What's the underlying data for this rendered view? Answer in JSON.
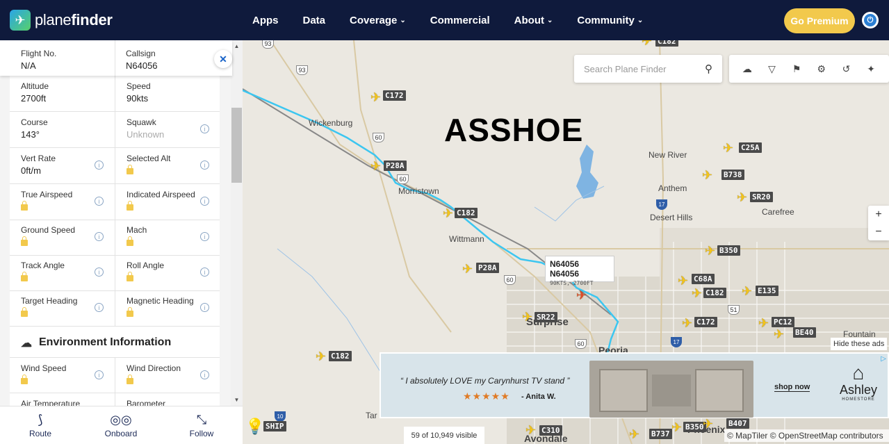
{
  "nav": {
    "brand_plain": "plane",
    "brand_bold": "finder",
    "links": [
      {
        "label": "Apps",
        "dropdown": false
      },
      {
        "label": "Data",
        "dropdown": false
      },
      {
        "label": "Coverage",
        "dropdown": true
      },
      {
        "label": "Commercial",
        "dropdown": false
      },
      {
        "label": "About",
        "dropdown": true
      },
      {
        "label": "Community",
        "dropdown": true
      }
    ],
    "premium_label": "Go Premium",
    "colors": {
      "bar": "#0f1a3c",
      "premium": "#f2c94c"
    }
  },
  "flight_panel": {
    "flight_no_label": "Flight No.",
    "flight_no_value": "N/A",
    "callsign_label": "Callsign",
    "callsign_value": "N64056",
    "close_icon": "close-icon",
    "rows": [
      {
        "left_label": "Altitude",
        "left_value": "2700ft",
        "right_label": "Speed",
        "right_value": "90kts"
      },
      {
        "left_label": "Course",
        "left_value": "143°",
        "right_label": "Squawk",
        "right_value": "Unknown"
      },
      {
        "left_label": "Vert Rate",
        "left_value": "0ft/m",
        "right_label": "Selected Alt",
        "right_value": ""
      },
      {
        "left_label": "True Airspeed",
        "left_value": "",
        "right_label": "Indicated Airspeed",
        "right_value": ""
      },
      {
        "left_label": "Ground Speed",
        "left_value": "",
        "right_label": "Mach",
        "right_value": ""
      },
      {
        "left_label": "Track Angle",
        "left_value": "",
        "right_label": "Roll Angle",
        "right_value": ""
      },
      {
        "left_label": "Target Heading",
        "left_value": "",
        "right_label": "Magnetic Heading",
        "right_value": ""
      }
    ],
    "environment_title": "Environment Information",
    "env_rows": [
      {
        "left_label": "Wind Speed",
        "right_label": "Wind Direction"
      },
      {
        "left_label": "Air Temperature",
        "right_label": "Barometer"
      }
    ]
  },
  "bottom_bar": {
    "items": [
      {
        "label": "Route",
        "icon": "route-icon"
      },
      {
        "label": "Onboard",
        "icon": "binoculars-icon"
      },
      {
        "label": "Follow",
        "icon": "follow-icon"
      }
    ]
  },
  "map": {
    "overlay_title": "ASSHOE",
    "search_placeholder": "Search Plane Finder",
    "toolbar_icons": [
      "cloud-download-icon",
      "filter-icon",
      "bookmark-icon",
      "gear-icon",
      "history-icon",
      "layers-icon"
    ],
    "zoom_in": "+",
    "zoom_out": "−",
    "tooltip": {
      "title": "N64056 N64056",
      "subtitle": "90KTS, 2700FT"
    },
    "places": [
      "Wickenburg",
      "Morristown",
      "Wittmann",
      "New River",
      "Anthem",
      "Desert Hills",
      "Carefree",
      "Surprise",
      "Peoria",
      "Fountain",
      "Phoenix",
      "Avondale",
      "Tar"
    ],
    "highway_shields": [
      "93",
      "93",
      "60",
      "60",
      "60",
      "60",
      "17",
      "17",
      "51",
      "10"
    ],
    "aircraft_labels": [
      "C182",
      "C172",
      "P28A",
      "C182",
      "P28A",
      "SR22",
      "C182",
      "C25A",
      "B738",
      "SR20",
      "B350",
      "C68A",
      "C182",
      "E135",
      "C172",
      "PC12",
      "BE40",
      "C310",
      "B737",
      "B350",
      "B407",
      "SHIP"
    ],
    "hide_ads_label": "Hide these ads",
    "visible_count": "59 of 10,949 visible",
    "attribution": "© MapTiler © OpenStreetMap contributors",
    "colors": {
      "track": "#3cc6f0",
      "aircraft": "#f5c518",
      "water": "#7fb4e2"
    }
  },
  "ad": {
    "quote_open": "“",
    "quote": "I absolutely LOVE my Carynhurst TV stand",
    "quote_close": "”",
    "stars": "★★★★★",
    "author": "- Anita W.",
    "cta": "shop now",
    "brand": "Ashley",
    "brand_sub": "HOMESTORE"
  }
}
